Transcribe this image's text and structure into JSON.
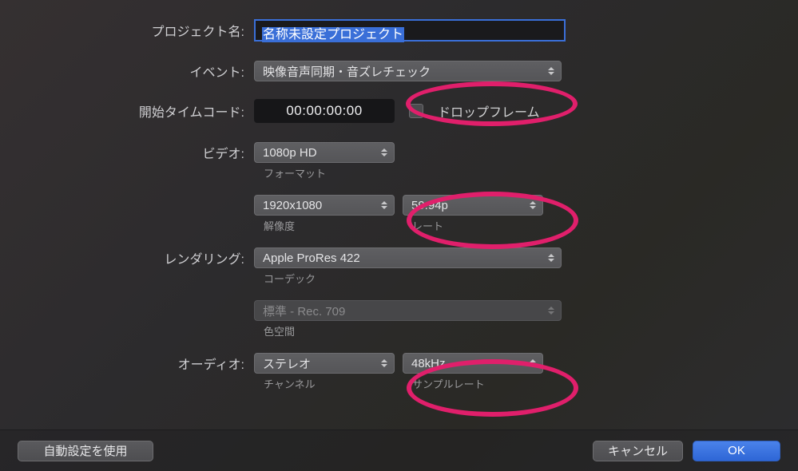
{
  "labels": {
    "project_name": "プロジェクト名:",
    "event": "イベント:",
    "start_tc": "開始タイムコード:",
    "video": "ビデオ:",
    "rendering": "レンダリング:",
    "audio": "オーディオ:"
  },
  "fields": {
    "project_name_value": "名称未設定プロジェクト",
    "event_value": "映像音声同期・音ズレチェック",
    "timecode": "00:00:00:00",
    "drop_frame_label": "ドロップフレーム",
    "video_format": "1080p HD",
    "video_format_sub": "フォーマット",
    "video_res": "1920x1080",
    "video_res_sub": "解像度",
    "video_rate": "59.94p",
    "video_rate_sub": "レート",
    "render_codec": "Apple ProRes 422",
    "render_codec_sub": "コーデック",
    "render_colorspace": "標準 - Rec. 709",
    "render_colorspace_sub": "色空間",
    "audio_channels": "ステレオ",
    "audio_channels_sub": "チャンネル",
    "audio_samplerate": "48kHz",
    "audio_samplerate_sub": "サンプルレート"
  },
  "footer": {
    "auto": "自動設定を使用",
    "cancel": "キャンセル",
    "ok": "OK"
  },
  "annotations": {
    "ring_color": "#e01f6b"
  }
}
